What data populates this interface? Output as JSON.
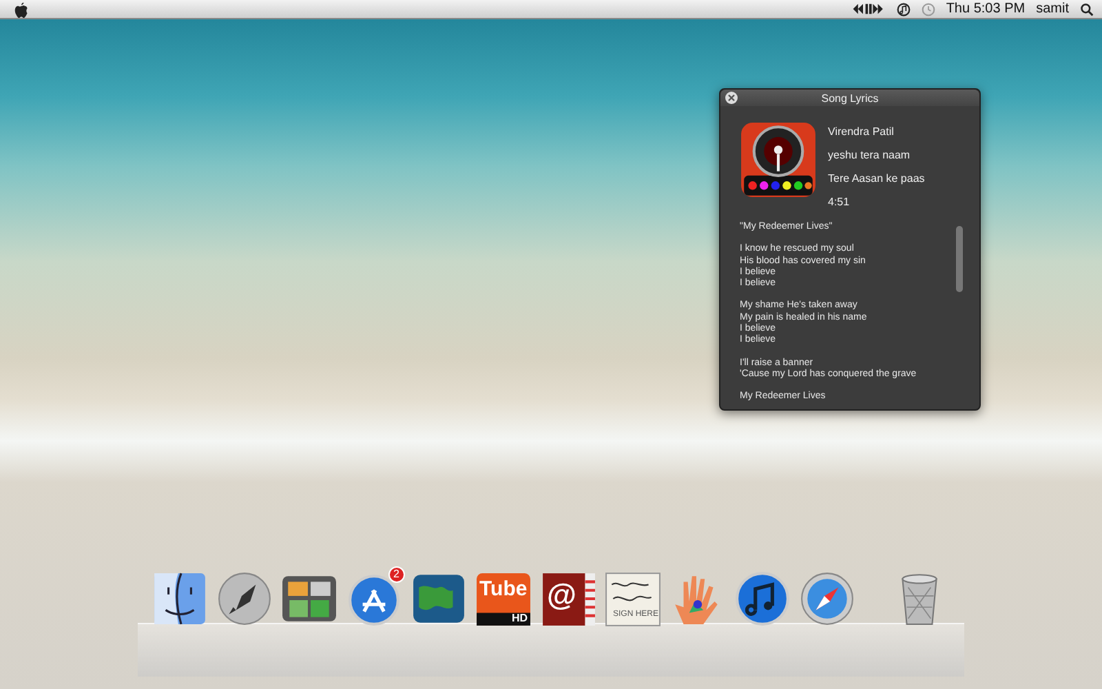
{
  "menu_bar": {
    "clock": "Thu 5:03 PM",
    "user": "samit"
  },
  "lyrics_window": {
    "title": "Song Lyrics",
    "track": {
      "artist": "Virendra Patil",
      "album": "yeshu tera naam",
      "song": "Tere Aasan ke paas",
      "duration": "4:51"
    },
    "lyrics": [
      {
        "lines": [
          "\"My Redeemer Lives\""
        ]
      },
      {
        "lines": [
          "I know he rescued my soul",
          "His blood has covered my sin",
          "I believe",
          "I believe"
        ]
      },
      {
        "lines": [
          "My shame He's taken away",
          "My pain is healed in his name",
          "I believe",
          "I believe"
        ]
      },
      {
        "lines": [
          "I'll raise a banner",
          "'Cause my Lord has conquered the grave"
        ]
      },
      {
        "lines": [
          "My Redeemer Lives"
        ]
      }
    ]
  },
  "dock": {
    "items": [
      {
        "kind": "finder"
      },
      {
        "kind": "launchpad"
      },
      {
        "kind": "mission-control"
      },
      {
        "kind": "app-store",
        "badge": "2"
      },
      {
        "kind": "globe"
      },
      {
        "kind": "tube",
        "text": "Tube",
        "subtext": "HD"
      },
      {
        "kind": "address-book",
        "text": "@"
      },
      {
        "kind": "signature",
        "text": "SIGN HERE"
      },
      {
        "kind": "paint-hand"
      },
      {
        "kind": "music"
      },
      {
        "kind": "compass"
      },
      {
        "kind": "trash"
      }
    ]
  }
}
